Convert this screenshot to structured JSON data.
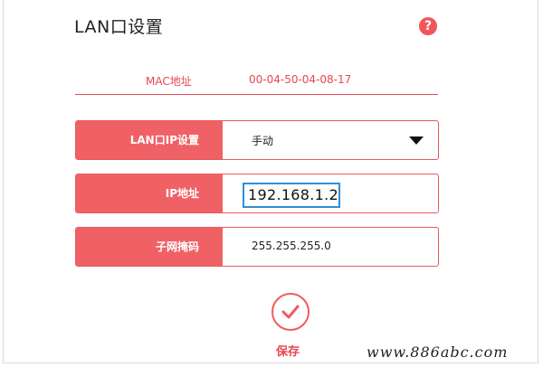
{
  "page": {
    "title": "LAN口设置",
    "help_icon": "?"
  },
  "mac": {
    "label": "MAC地址",
    "value": "00-04-50-04-08-17"
  },
  "lan_ip_mode": {
    "label": "LAN口IP设置",
    "value": "手动"
  },
  "ip_address": {
    "label": "IP地址",
    "value": "192.168.1.2"
  },
  "subnet_mask": {
    "label": "子网掩码",
    "value": "255.255.255.0"
  },
  "save": {
    "label": "保存"
  },
  "watermark": "www.886abc.com",
  "colors": {
    "accent": "#f06166",
    "accent_text": "#e8474f",
    "focus_border": "#2f8ed8"
  }
}
